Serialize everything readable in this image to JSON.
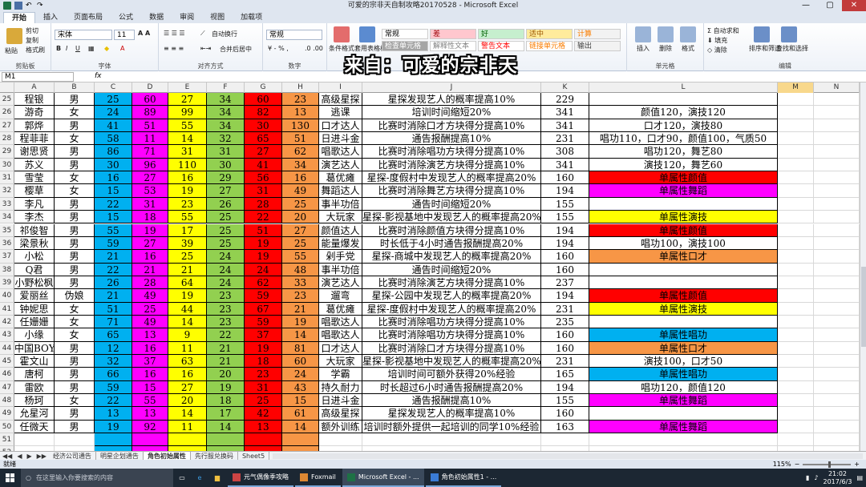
{
  "window": {
    "title": "可爱的宗非天自制攻略20170528 - Microsoft Excel"
  },
  "ribbon_tabs": [
    "开始",
    "插入",
    "页面布局",
    "公式",
    "数据",
    "审阅",
    "视图",
    "加载项"
  ],
  "ribbon": {
    "clipboard": {
      "paste": "粘贴",
      "cut": "剪切",
      "copy": "复制",
      "format_painter": "格式刷",
      "label": "剪贴板"
    },
    "font": {
      "name": "宋体",
      "size": "11",
      "label": "字体"
    },
    "alignment": {
      "wrap": "自动换行",
      "merge": "合并后居中",
      "label": "对齐方式"
    },
    "number": {
      "format": "常规",
      "label": "数字"
    },
    "styles": {
      "cond_format": "条件格式",
      "table_format": "套用表格格式",
      "cell_styles": "单元格样式",
      "label": "样式",
      "cells": [
        {
          "text": "常规",
          "bg": "#ffffff",
          "color": "#000000"
        },
        {
          "text": "差",
          "bg": "#ffc7ce",
          "color": "#9c0006"
        },
        {
          "text": "好",
          "bg": "#c6efce",
          "color": "#006100"
        },
        {
          "text": "适中",
          "bg": "#ffeb9c",
          "color": "#9c5700"
        },
        {
          "text": "计算",
          "bg": "#f2f2f2",
          "color": "#fa7d00"
        },
        {
          "text": "检查单元格",
          "bg": "#a5a5a5",
          "color": "#ffffff"
        },
        {
          "text": "解释性文本",
          "bg": "#ffffff",
          "color": "#7f7f7f"
        },
        {
          "text": "警告文本",
          "bg": "#ffffff",
          "color": "#ff0000"
        },
        {
          "text": "链接单元格",
          "bg": "#ffffff",
          "color": "#fa7d00"
        },
        {
          "text": "输出",
          "bg": "#f2f2f2",
          "color": "#3f3f3f"
        }
      ]
    },
    "cells": {
      "insert": "插入",
      "delete": "删除",
      "format": "格式",
      "label": "单元格"
    },
    "editing": {
      "autosum": "自动求和",
      "fill": "填充",
      "clear": "清除",
      "sort": "排序和筛选",
      "find": "查找和选择",
      "label": "编辑"
    }
  },
  "formula_bar": {
    "name_box": "M1",
    "fx": "fx",
    "formula": ""
  },
  "overlay_text": "来自：可爱的宗非天",
  "columns": [
    "A",
    "B",
    "C",
    "D",
    "E",
    "F",
    "G",
    "H",
    "I",
    "J",
    "K",
    "L",
    "M",
    "N"
  ],
  "selected_column": "M",
  "stat_colors": [
    "#00b0f0",
    "#ff00ff",
    "#ffff00",
    "#92d050",
    "#ff0000",
    "#f79646"
  ],
  "rows": [
    {
      "r": "25",
      "name": "程银",
      "sex": "男",
      "s": [
        "25",
        "60",
        "27",
        "34",
        "60",
        "23"
      ],
      "skill": "高级星探",
      "desc": "星探发现艺人的概率提高10%",
      "k": "229",
      "l": "",
      "lbg": ""
    },
    {
      "r": "26",
      "name": "游奇",
      "sex": "女",
      "s": [
        "24",
        "89",
        "99",
        "34",
        "82",
        "13"
      ],
      "skill": "逃课",
      "desc": "培训时间缩短20%",
      "k": "341",
      "l": "颜值120，演技120",
      "lbg": ""
    },
    {
      "r": "27",
      "name": "郭烨",
      "sex": "男",
      "s": [
        "41",
        "51",
        "55",
        "34",
        "30",
        "130"
      ],
      "skill": "口才达人",
      "desc": "比赛时消除口才方块得分提高10%",
      "k": "341",
      "l": "口才120，演技80",
      "lbg": ""
    },
    {
      "r": "28",
      "name": "程菲菲",
      "sex": "女",
      "s": [
        "58",
        "11",
        "14",
        "32",
        "65",
        "51"
      ],
      "skill": "日进斗金",
      "desc": "通告报酬提高10%",
      "k": "231",
      "l": "唱功110，口才90，颜值100，气质50",
      "lbg": ""
    },
    {
      "r": "29",
      "name": "谢思贤",
      "sex": "男",
      "s": [
        "86",
        "71",
        "31",
        "31",
        "27",
        "62"
      ],
      "skill": "唱歌达人",
      "desc": "比赛时消除唱功方块得分提高10%",
      "k": "308",
      "l": "唱功120，舞艺80",
      "lbg": ""
    },
    {
      "r": "30",
      "name": "苏义",
      "sex": "男",
      "s": [
        "30",
        "96",
        "110",
        "30",
        "41",
        "34"
      ],
      "skill": "演艺达人",
      "desc": "比赛时消除演艺方块得分提高10%",
      "k": "341",
      "l": "演技120，舞艺60",
      "lbg": ""
    },
    {
      "r": "31",
      "name": "雪莹",
      "sex": "女",
      "s": [
        "16",
        "27",
        "16",
        "29",
        "56",
        "16"
      ],
      "skill": "葛优瘫",
      "desc": "星探-度假村中发现艺人的概率提高20%",
      "k": "160",
      "l": "单属性颜值",
      "lbg": "#ff0000"
    },
    {
      "r": "32",
      "name": "樱草",
      "sex": "女",
      "s": [
        "15",
        "53",
        "19",
        "27",
        "31",
        "49"
      ],
      "skill": "舞蹈达人",
      "desc": "比赛时消除舞艺方块得分提高10%",
      "k": "194",
      "l": "单属性舞蹈",
      "lbg": "#ff00ff"
    },
    {
      "r": "33",
      "name": "李凡",
      "sex": "男",
      "s": [
        "22",
        "31",
        "23",
        "26",
        "28",
        "25"
      ],
      "skill": "事半功倍",
      "desc": "通告时间缩短20%",
      "k": "155",
      "l": "",
      "lbg": ""
    },
    {
      "r": "34",
      "name": "李杰",
      "sex": "男",
      "s": [
        "15",
        "18",
        "55",
        "25",
        "22",
        "20"
      ],
      "skill": "大玩家",
      "desc": "星探-影视基地中发现艺人的概率提高20%",
      "k": "155",
      "l": "单属性演技",
      "lbg": "#ffff00"
    },
    {
      "r": "35",
      "name": "祁俊智",
      "sex": "男",
      "s": [
        "55",
        "19",
        "17",
        "25",
        "51",
        "27"
      ],
      "skill": "颜值达人",
      "desc": "比赛时消除颜值方块得分提高10%",
      "k": "194",
      "l": "单属性颜值",
      "lbg": "#ff0000"
    },
    {
      "r": "36",
      "name": "梁景秋",
      "sex": "男",
      "s": [
        "59",
        "27",
        "39",
        "25",
        "19",
        "25"
      ],
      "skill": "能量爆发",
      "desc": "时长低于4小时通告报酬提高20%",
      "k": "194",
      "l": "唱功100，演技100",
      "lbg": ""
    },
    {
      "r": "37",
      "name": "小松",
      "sex": "男",
      "s": [
        "21",
        "16",
        "25",
        "24",
        "19",
        "55"
      ],
      "skill": "剁手党",
      "desc": "星探-商城中发现艺人的概率提高20%",
      "k": "160",
      "l": "单属性口才",
      "lbg": "#f79646"
    },
    {
      "r": "38",
      "name": "Q君",
      "sex": "男",
      "s": [
        "22",
        "21",
        "21",
        "24",
        "24",
        "48"
      ],
      "skill": "事半功倍",
      "desc": "通告时间缩短20%",
      "k": "160",
      "l": "",
      "lbg": ""
    },
    {
      "r": "39",
      "name": "小野松枫",
      "sex": "男",
      "s": [
        "26",
        "28",
        "64",
        "24",
        "62",
        "33"
      ],
      "skill": "演艺达人",
      "desc": "比赛时消除演艺方块得分提高10%",
      "k": "237",
      "l": "",
      "lbg": ""
    },
    {
      "r": "40",
      "name": "爱丽丝",
      "sex": "伪娘",
      "s": [
        "21",
        "49",
        "19",
        "23",
        "59",
        "23"
      ],
      "skill": "遛弯",
      "desc": "星探-公园中发现艺人的概率提高20%",
      "k": "194",
      "l": "单属性颜值",
      "lbg": "#ff0000"
    },
    {
      "r": "41",
      "name": "钟妮思",
      "sex": "女",
      "s": [
        "51",
        "25",
        "44",
        "23",
        "67",
        "21"
      ],
      "skill": "葛优瘫",
      "desc": "星探-度假村中发现艺人的概率提高20%",
      "k": "231",
      "l": "单属性演技",
      "lbg": "#ffff00"
    },
    {
      "r": "42",
      "name": "任姗姗",
      "sex": "女",
      "s": [
        "71",
        "49",
        "14",
        "23",
        "59",
        "19"
      ],
      "skill": "唱歌达人",
      "desc": "比赛时消除唱功方块得分提高10%",
      "k": "235",
      "l": "",
      "lbg": ""
    },
    {
      "r": "43",
      "name": "小缘",
      "sex": "女",
      "s": [
        "65",
        "13",
        "9",
        "22",
        "37",
        "14"
      ],
      "skill": "唱歌达人",
      "desc": "比赛时消除唱功方块得分提高10%",
      "k": "160",
      "l": "单属性唱功",
      "lbg": "#00b0f0"
    },
    {
      "r": "44",
      "name": "中国BOY",
      "sex": "男",
      "s": [
        "12",
        "16",
        "11",
        "21",
        "19",
        "81"
      ],
      "skill": "口才达人",
      "desc": "比赛时消除口才方块得分提高10%",
      "k": "160",
      "l": "单属性口才",
      "lbg": "#f79646"
    },
    {
      "r": "45",
      "name": "霍文山",
      "sex": "男",
      "s": [
        "32",
        "37",
        "63",
        "21",
        "18",
        "60"
      ],
      "skill": "大玩家",
      "desc": "星探-影视基地中发现艺人的概率提高20%",
      "k": "231",
      "l": "演技100，口才50",
      "lbg": ""
    },
    {
      "r": "46",
      "name": "唐柯",
      "sex": "男",
      "s": [
        "66",
        "16",
        "16",
        "20",
        "23",
        "24"
      ],
      "skill": "学霸",
      "desc": "培训时间可额外获得20%经验",
      "k": "165",
      "l": "单属性唱功",
      "lbg": "#00b0f0"
    },
    {
      "r": "47",
      "name": "雷欧",
      "sex": "男",
      "s": [
        "59",
        "15",
        "27",
        "19",
        "31",
        "43"
      ],
      "skill": "持久耐力",
      "desc": "时长超过6小时通告报酬提高20%",
      "k": "194",
      "l": "唱功120，颜值120",
      "lbg": ""
    },
    {
      "r": "48",
      "name": "杨珂",
      "sex": "女",
      "s": [
        "22",
        "55",
        "20",
        "18",
        "25",
        "15"
      ],
      "skill": "日进斗金",
      "desc": "通告报酬提高10%",
      "k": "155",
      "l": "单属性舞蹈",
      "lbg": "#ff00ff"
    },
    {
      "r": "49",
      "name": "允星河",
      "sex": "男",
      "s": [
        "13",
        "13",
        "14",
        "17",
        "42",
        "61"
      ],
      "skill": "高级星探",
      "desc": "星探发现艺人的概率提高10%",
      "k": "160",
      "l": "",
      "lbg": ""
    },
    {
      "r": "50",
      "name": "任微天",
      "sex": "男",
      "s": [
        "19",
        "92",
        "11",
        "14",
        "13",
        "14"
      ],
      "skill": "额外训练",
      "desc": "培训时额外提供一起培训的同学10%经验",
      "k": "163",
      "l": "单属性舞蹈",
      "lbg": "#ff00ff"
    },
    {
      "r": "51",
      "name": "",
      "sex": "",
      "s": [
        "",
        "",
        "",
        "",
        "",
        ""
      ],
      "skill": "",
      "desc": "",
      "k": "",
      "l": "",
      "lbg": ""
    },
    {
      "r": "52",
      "name": "",
      "sex": "",
      "s": [
        "",
        "",
        "",
        "",
        "",
        ""
      ],
      "skill": "",
      "desc": "",
      "k": "",
      "l": "",
      "lbg": ""
    }
  ],
  "sheet_tabs": [
    {
      "name": "经济公司通告",
      "active": false
    },
    {
      "name": "明星企划通告",
      "active": false
    },
    {
      "name": "角色初始属性",
      "active": true
    },
    {
      "name": "先行服兑换码",
      "active": false
    },
    {
      "name": "Sheet5",
      "active": false
    }
  ],
  "status": {
    "ready": "就绪",
    "zoom": "115%"
  },
  "taskbar": {
    "search_placeholder": "在这里输入你要搜索的内容",
    "tasks": [
      {
        "label": "元气偶像季攻略",
        "active": false
      },
      {
        "label": "Foxmail",
        "active": false
      },
      {
        "label": "Microsoft Excel - ...",
        "active": true
      },
      {
        "label": "角色初始属性1 - ...",
        "active": false
      }
    ],
    "time": "21:02",
    "date": "2017/6/3"
  }
}
